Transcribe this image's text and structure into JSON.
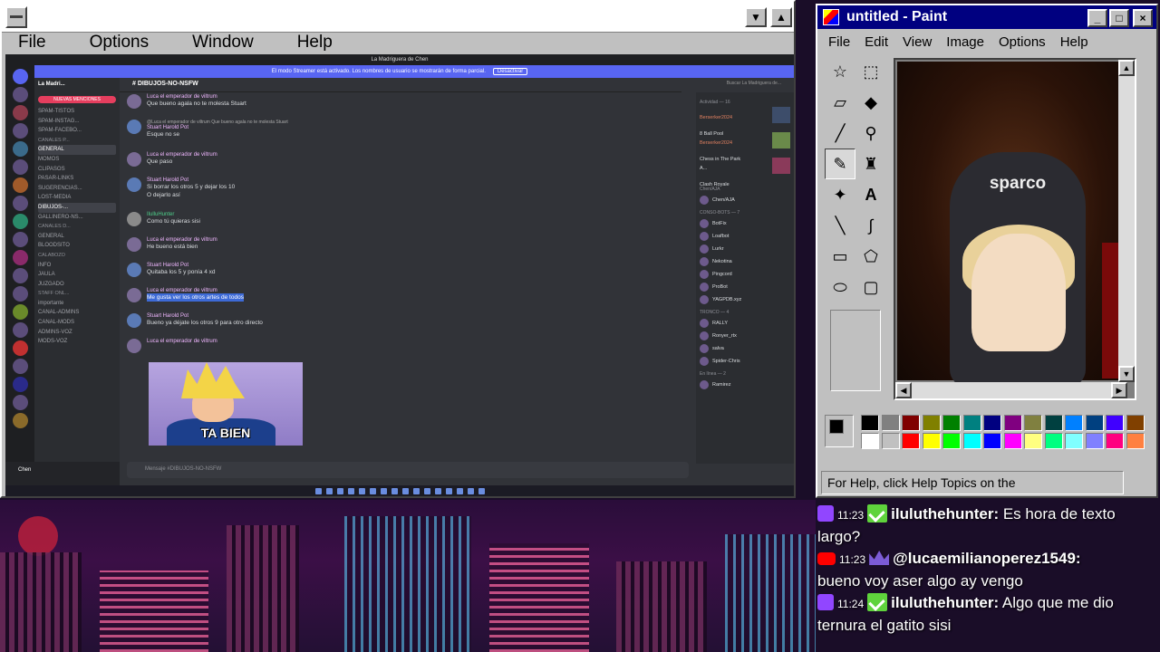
{
  "stream_window": {
    "menu": [
      "File",
      "Options",
      "Window",
      "Help"
    ],
    "scroll_down": "▼",
    "scroll_up": "▲"
  },
  "discord": {
    "window_title": "La Madriguera de Chen",
    "banner_text": "El modo Streamer está activado. Los nombres de usuario se mostrarán de forma parcial.",
    "banner_button": "Desactivar",
    "server_name": "La Madri...",
    "mentions_label": "NUEVAS MENCIONES",
    "channels": [
      {
        "label": "SPAM-TISTOS",
        "type": "ch"
      },
      {
        "label": "SPAM-INSTAG...",
        "type": "ch"
      },
      {
        "label": "SPAM-FACEBO...",
        "type": "ch"
      },
      {
        "label": "CANALES P...",
        "type": "cat"
      },
      {
        "label": "GENERAL",
        "type": "act"
      },
      {
        "label": "MOMOS",
        "type": "ch"
      },
      {
        "label": "CLIPASOS",
        "type": "ch"
      },
      {
        "label": "PASAR-LINKS",
        "type": "ch"
      },
      {
        "label": "SUGERENCIAS...",
        "type": "ch"
      },
      {
        "label": "LOST-MEDIA",
        "type": "ch"
      },
      {
        "label": "DIBUJOS-...",
        "type": "act"
      },
      {
        "label": "GALLINERO-NS...",
        "type": "ch"
      },
      {
        "label": "CANALES D...",
        "type": "cat"
      },
      {
        "label": "GENERAL",
        "type": "ch"
      },
      {
        "label": "BLOODSITO",
        "type": "ch"
      },
      {
        "label": "CALABOZO",
        "type": "cat"
      },
      {
        "label": "INFO",
        "type": "ch"
      },
      {
        "label": "JAULA",
        "type": "ch"
      },
      {
        "label": "JUZGADO",
        "type": "ch"
      },
      {
        "label": "STAFF ONL...",
        "type": "cat"
      },
      {
        "label": "importante",
        "type": "ch"
      },
      {
        "label": "CANAL-ADMINS",
        "type": "ch"
      },
      {
        "label": "CANAL-MODS",
        "type": "ch"
      },
      {
        "label": "ADMINS-VOZ",
        "type": "ch"
      },
      {
        "label": "MODS-VOZ",
        "type": "ch"
      }
    ],
    "user_name": "Chen",
    "channel_header": "DIBUJOS-NO-NSFW",
    "search_placeholder": "Buscar La Madriguera de...",
    "composer_placeholder": "Mensaje #DIBUJOS-NO-NSFW",
    "messages": [
      {
        "name": "Luca el emperador de viltrum",
        "text": "Que bueno agala no te molesta Stuart"
      },
      {
        "name": "Stuart Harold Pot",
        "reply": "@Luca el emperador de viltrum Que bueno agala no te molesta Stuart",
        "text": "Esque no se"
      },
      {
        "name": "Luca el emperador de viltrum",
        "text": "Que paso"
      },
      {
        "name": "Stuart Harold Pot",
        "text": "Si borrar los otros 5 y dejar los 10",
        "text2": "O dejarlo así"
      },
      {
        "name": "IlulluHunter",
        "text": "Como tú quieras sisi"
      },
      {
        "name": "Luca el emperador de viltrum",
        "text": "He bueno está bien"
      },
      {
        "name": "Stuart Harold Pot",
        "text": "Quitaba los 5 y ponía 4 xd"
      },
      {
        "name": "Luca el emperador de viltrum",
        "text": "Me gusta ver los otros artes de todos"
      },
      {
        "name": "Stuart Harold Pot",
        "text": "Bueno ya déjate los otros 9 para otro directo"
      },
      {
        "name": "Luca el emperador de viltrum",
        "text": ""
      }
    ],
    "gif_caption": "TA BIEN",
    "members_activity_header": "Actividad — 16",
    "activities": [
      {
        "name": "Berserker2024",
        "game": "8 Ball Pool"
      },
      {
        "name": "Berserker2024",
        "game": "Chess in The Park"
      },
      {
        "name": "A...",
        "game": "Clash Royale"
      }
    ],
    "members": [
      {
        "group": "Chen/AJA",
        "name": "Chen/AJA"
      },
      {
        "group": "CONSO-BOTS — 7",
        "name": "BotFix"
      },
      {
        "group": "",
        "name": "Loafbot"
      },
      {
        "group": "",
        "name": "Lurkr"
      },
      {
        "group": "",
        "name": "Nekotina"
      },
      {
        "group": "",
        "name": "Pingcord"
      },
      {
        "group": "",
        "name": "ProBot"
      },
      {
        "group": "",
        "name": "YAGPDB.xyz"
      },
      {
        "group": "TRONCO — 4",
        "name": "RALLY"
      },
      {
        "group": "",
        "name": "Ronyer_rtx"
      },
      {
        "group": "",
        "name": "salva"
      },
      {
        "group": "",
        "name": "Spider-Chris"
      },
      {
        "group": "En línea — 2",
        "name": "Ramirez"
      }
    ]
  },
  "paint": {
    "title": "untitled - Paint",
    "menu": [
      "File",
      "Edit",
      "View",
      "Image",
      "Options",
      "Help"
    ],
    "canvas_brand": "sparco",
    "status_text": "For Help, click Help Topics on the",
    "colors_top": [
      "#000000",
      "#808080",
      "#800000",
      "#808000",
      "#008000",
      "#008080",
      "#000080",
      "#800080",
      "#808040",
      "#004040",
      "#0080ff",
      "#004080",
      "#4000ff",
      "#804000"
    ],
    "colors_bottom": [
      "#ffffff",
      "#c0c0c0",
      "#ff0000",
      "#ffff00",
      "#00ff00",
      "#00ffff",
      "#0000ff",
      "#ff00ff",
      "#ffff80",
      "#00ff80",
      "#80ffff",
      "#8080ff",
      "#ff0080",
      "#ff8040"
    ],
    "foreground": "#000000",
    "background": "#ffffff"
  },
  "chat": [
    {
      "platform": "twitch",
      "time": "11:23",
      "user": "iluluthehunter:",
      "text": " Es hora de texto largo?"
    },
    {
      "platform": "youtube",
      "time": "11:23",
      "user": "@lucaemilianoperez1549:",
      "text": " bueno voy aser algo ay vengo"
    },
    {
      "platform": "twitch",
      "time": "11:24",
      "user": "iluluthehunter:",
      "text": " Algo que me dio ternura el gatito sisi"
    }
  ]
}
